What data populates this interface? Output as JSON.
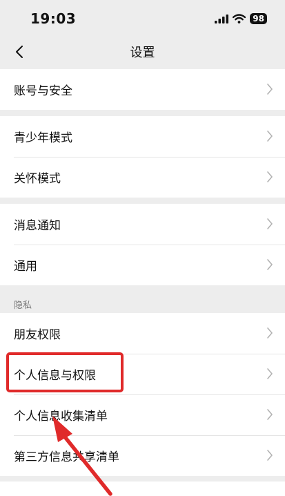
{
  "status_bar": {
    "time": "19:03",
    "battery": "98"
  },
  "nav": {
    "title": "设置"
  },
  "groups": {
    "account": {
      "items": [
        {
          "label": "账号与安全"
        }
      ]
    },
    "modes": {
      "items": [
        {
          "label": "青少年模式"
        },
        {
          "label": "关怀模式"
        }
      ]
    },
    "general": {
      "items": [
        {
          "label": "消息通知"
        },
        {
          "label": "通用"
        }
      ]
    },
    "privacy": {
      "header": "隐私",
      "items": [
        {
          "label": "朋友权限"
        },
        {
          "label": "个人信息与权限"
        },
        {
          "label": "个人信息收集清单"
        },
        {
          "label": "第三方信息共享清单"
        }
      ]
    }
  },
  "annotation": {
    "color": "#e02a2a"
  }
}
